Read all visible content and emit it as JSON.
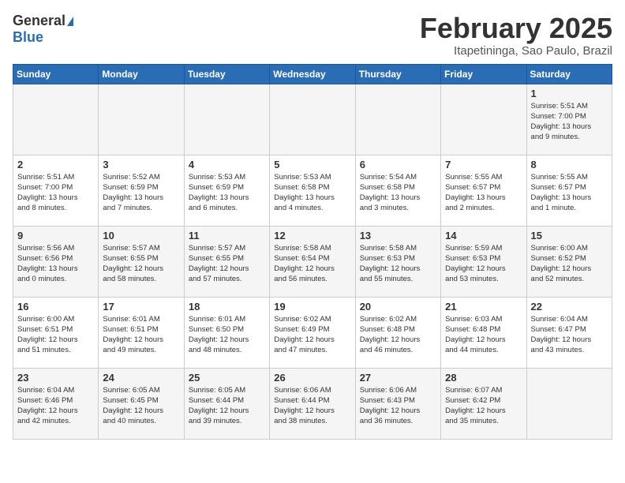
{
  "header": {
    "logo_general": "General",
    "logo_blue": "Blue",
    "month_title": "February 2025",
    "location": "Itapetininga, Sao Paulo, Brazil"
  },
  "days_of_week": [
    "Sunday",
    "Monday",
    "Tuesday",
    "Wednesday",
    "Thursday",
    "Friday",
    "Saturday"
  ],
  "weeks": [
    [
      {
        "day": "",
        "info": ""
      },
      {
        "day": "",
        "info": ""
      },
      {
        "day": "",
        "info": ""
      },
      {
        "day": "",
        "info": ""
      },
      {
        "day": "",
        "info": ""
      },
      {
        "day": "",
        "info": ""
      },
      {
        "day": "1",
        "info": "Sunrise: 5:51 AM\nSunset: 7:00 PM\nDaylight: 13 hours\nand 9 minutes."
      }
    ],
    [
      {
        "day": "2",
        "info": "Sunrise: 5:51 AM\nSunset: 7:00 PM\nDaylight: 13 hours\nand 8 minutes."
      },
      {
        "day": "3",
        "info": "Sunrise: 5:52 AM\nSunset: 6:59 PM\nDaylight: 13 hours\nand 7 minutes."
      },
      {
        "day": "4",
        "info": "Sunrise: 5:53 AM\nSunset: 6:59 PM\nDaylight: 13 hours\nand 6 minutes."
      },
      {
        "day": "5",
        "info": "Sunrise: 5:53 AM\nSunset: 6:58 PM\nDaylight: 13 hours\nand 4 minutes."
      },
      {
        "day": "6",
        "info": "Sunrise: 5:54 AM\nSunset: 6:58 PM\nDaylight: 13 hours\nand 3 minutes."
      },
      {
        "day": "7",
        "info": "Sunrise: 5:55 AM\nSunset: 6:57 PM\nDaylight: 13 hours\nand 2 minutes."
      },
      {
        "day": "8",
        "info": "Sunrise: 5:55 AM\nSunset: 6:57 PM\nDaylight: 13 hours\nand 1 minute."
      }
    ],
    [
      {
        "day": "9",
        "info": "Sunrise: 5:56 AM\nSunset: 6:56 PM\nDaylight: 13 hours\nand 0 minutes."
      },
      {
        "day": "10",
        "info": "Sunrise: 5:57 AM\nSunset: 6:55 PM\nDaylight: 12 hours\nand 58 minutes."
      },
      {
        "day": "11",
        "info": "Sunrise: 5:57 AM\nSunset: 6:55 PM\nDaylight: 12 hours\nand 57 minutes."
      },
      {
        "day": "12",
        "info": "Sunrise: 5:58 AM\nSunset: 6:54 PM\nDaylight: 12 hours\nand 56 minutes."
      },
      {
        "day": "13",
        "info": "Sunrise: 5:58 AM\nSunset: 6:53 PM\nDaylight: 12 hours\nand 55 minutes."
      },
      {
        "day": "14",
        "info": "Sunrise: 5:59 AM\nSunset: 6:53 PM\nDaylight: 12 hours\nand 53 minutes."
      },
      {
        "day": "15",
        "info": "Sunrise: 6:00 AM\nSunset: 6:52 PM\nDaylight: 12 hours\nand 52 minutes."
      }
    ],
    [
      {
        "day": "16",
        "info": "Sunrise: 6:00 AM\nSunset: 6:51 PM\nDaylight: 12 hours\nand 51 minutes."
      },
      {
        "day": "17",
        "info": "Sunrise: 6:01 AM\nSunset: 6:51 PM\nDaylight: 12 hours\nand 49 minutes."
      },
      {
        "day": "18",
        "info": "Sunrise: 6:01 AM\nSunset: 6:50 PM\nDaylight: 12 hours\nand 48 minutes."
      },
      {
        "day": "19",
        "info": "Sunrise: 6:02 AM\nSunset: 6:49 PM\nDaylight: 12 hours\nand 47 minutes."
      },
      {
        "day": "20",
        "info": "Sunrise: 6:02 AM\nSunset: 6:48 PM\nDaylight: 12 hours\nand 46 minutes."
      },
      {
        "day": "21",
        "info": "Sunrise: 6:03 AM\nSunset: 6:48 PM\nDaylight: 12 hours\nand 44 minutes."
      },
      {
        "day": "22",
        "info": "Sunrise: 6:04 AM\nSunset: 6:47 PM\nDaylight: 12 hours\nand 43 minutes."
      }
    ],
    [
      {
        "day": "23",
        "info": "Sunrise: 6:04 AM\nSunset: 6:46 PM\nDaylight: 12 hours\nand 42 minutes."
      },
      {
        "day": "24",
        "info": "Sunrise: 6:05 AM\nSunset: 6:45 PM\nDaylight: 12 hours\nand 40 minutes."
      },
      {
        "day": "25",
        "info": "Sunrise: 6:05 AM\nSunset: 6:44 PM\nDaylight: 12 hours\nand 39 minutes."
      },
      {
        "day": "26",
        "info": "Sunrise: 6:06 AM\nSunset: 6:44 PM\nDaylight: 12 hours\nand 38 minutes."
      },
      {
        "day": "27",
        "info": "Sunrise: 6:06 AM\nSunset: 6:43 PM\nDaylight: 12 hours\nand 36 minutes."
      },
      {
        "day": "28",
        "info": "Sunrise: 6:07 AM\nSunset: 6:42 PM\nDaylight: 12 hours\nand 35 minutes."
      },
      {
        "day": "",
        "info": ""
      }
    ]
  ]
}
